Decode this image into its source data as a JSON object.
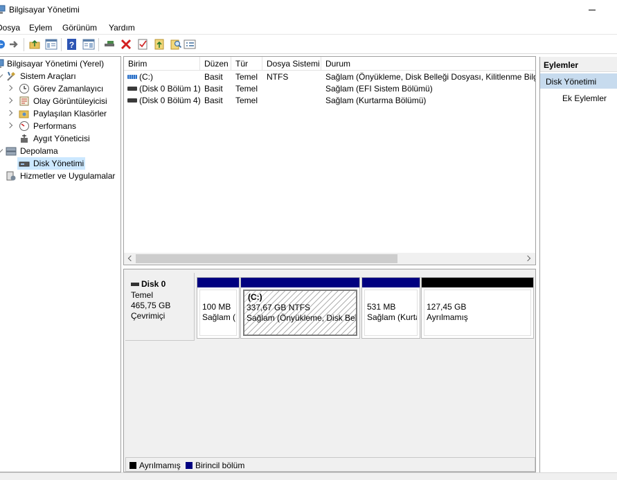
{
  "window": {
    "title": "Bilgisayar Yönetimi"
  },
  "menu": [
    "Dosya",
    "Eylem",
    "Görünüm",
    "Yardım"
  ],
  "toolbar": {
    "buttons": [
      "back-icon",
      "forward-icon",
      "up-folder-icon",
      "show-tree-icon",
      "help-icon",
      "properties-view-icon",
      "connect-icon",
      "delete-icon",
      "check-icon",
      "import-icon",
      "find-icon",
      "list-view-icon"
    ]
  },
  "tree": {
    "root": "Bilgisayar Yönetimi (Yerel)",
    "system_tools": "Sistem Araçları",
    "task_scheduler": "Görev Zamanlayıcı",
    "event_viewer": "Olay Görüntüleyicisi",
    "shared_folders": "Paylaşılan Klasörler",
    "performance": "Performans",
    "device_manager": "Aygıt Yöneticisi",
    "storage": "Depolama",
    "disk_management": "Disk Yönetimi",
    "services": "Hizmetler ve Uygulamalar"
  },
  "volumes": {
    "columns": [
      "Birim",
      "Düzen",
      "Tür",
      "Dosya Sistemi",
      "Durum"
    ],
    "rows": [
      {
        "name": "(C:)",
        "layout": "Basit",
        "type": "Temel",
        "fs": "NTFS",
        "status": "Sağlam (Önyükleme, Disk Belleği Dosyası, Kilitlenme Bilgis"
      },
      {
        "name": "(Disk 0 Bölüm 1)",
        "layout": "Basit",
        "type": "Temel",
        "fs": "",
        "status": "Sağlam (EFI Sistem Bölümü)"
      },
      {
        "name": "(Disk 0 Bölüm 4)",
        "layout": "Basit",
        "type": "Temel",
        "fs": "",
        "status": "Sağlam (Kurtarma Bölümü)"
      }
    ]
  },
  "disk": {
    "name": "Disk 0",
    "type": "Temel",
    "size": "465,75 GB",
    "state": "Çevrimiçi",
    "partitions": [
      {
        "line1": "100 MB",
        "line2": "Sağlam ("
      },
      {
        "label": "(C:)",
        "line1": "337,67 GB NTFS",
        "line2": "Sağlam (Önyükleme, Disk Belli"
      },
      {
        "line1": "531 MB",
        "line2": "Sağlam (Kurta"
      },
      {
        "line1": "127,45 GB",
        "line2": "Ayrılmamış"
      }
    ]
  },
  "legend": {
    "unallocated": "Ayrılmamış",
    "primary": "Birincil bölüm",
    "unallocated_color": "#000000",
    "primary_color": "#000080"
  },
  "actions": {
    "header": "Eylemler",
    "section": "Disk Yönetimi",
    "more": "Ek Eylemler"
  }
}
